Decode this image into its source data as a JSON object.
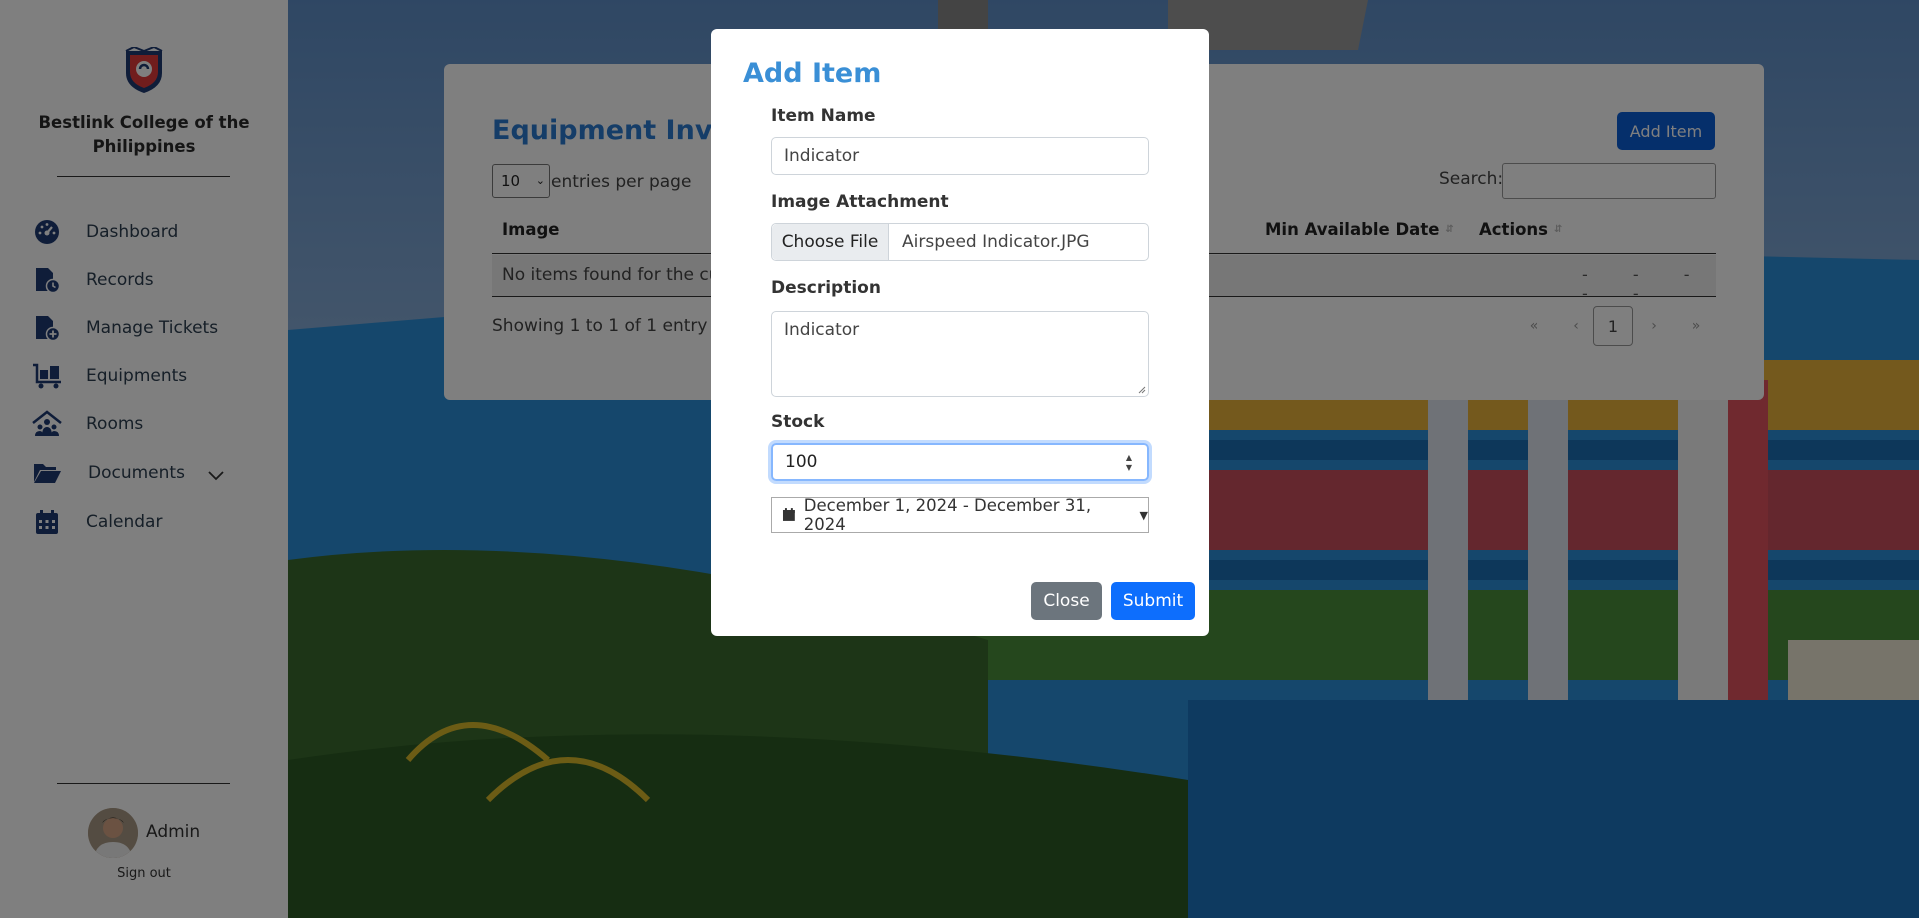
{
  "sidebar": {
    "brand": "Bestlink College of the Philippines",
    "items": [
      {
        "label": "Dashboard",
        "icon": "dashboard-gauge-icon"
      },
      {
        "label": "Records",
        "icon": "records-file-icon"
      },
      {
        "label": "Manage Tickets",
        "icon": "ticket-file-plus-icon"
      },
      {
        "label": "Equipments",
        "icon": "equipment-cart-icon"
      },
      {
        "label": "Rooms",
        "icon": "rooms-house-icon"
      },
      {
        "label": "Documents",
        "icon": "folder-open-icon"
      },
      {
        "label": "Calendar",
        "icon": "calendar-icon"
      }
    ],
    "user": {
      "name": "Admin",
      "signout": "Sign out"
    }
  },
  "main": {
    "title": "Equipment Invente",
    "add_button": "Add Item",
    "entries_value": "10",
    "entries_label": "entries per page",
    "search_label": "Search:",
    "columns": [
      {
        "label": "Image"
      },
      {
        "label": "Min Available Date"
      },
      {
        "label": "Actions"
      }
    ],
    "empty_text": "No items found for the cur",
    "dashes": "- - - - -",
    "showing": "Showing 1 to 1 of 1 entry",
    "pagination": {
      "first": "«",
      "prev": "‹",
      "current": "1",
      "next": "›",
      "last": "»"
    }
  },
  "modal": {
    "title": "Add Item",
    "item_name_label": "Item Name",
    "item_name_value": "Indicator",
    "image_label": "Image Attachment",
    "choose_file": "Choose File",
    "file_name": "Airspeed Indicator.JPG",
    "description_label": "Description",
    "description_value": "Indicator",
    "stock_label": "Stock",
    "stock_value": "100",
    "date_range": "December 1, 2024 - December 31, 2024",
    "close": "Close",
    "submit": "Submit"
  },
  "colors": {
    "primary": "#0d6efd",
    "title_blue": "#2a7bd1",
    "secondary": "#6c757d",
    "sidebar_icon": "#1f3b73"
  }
}
